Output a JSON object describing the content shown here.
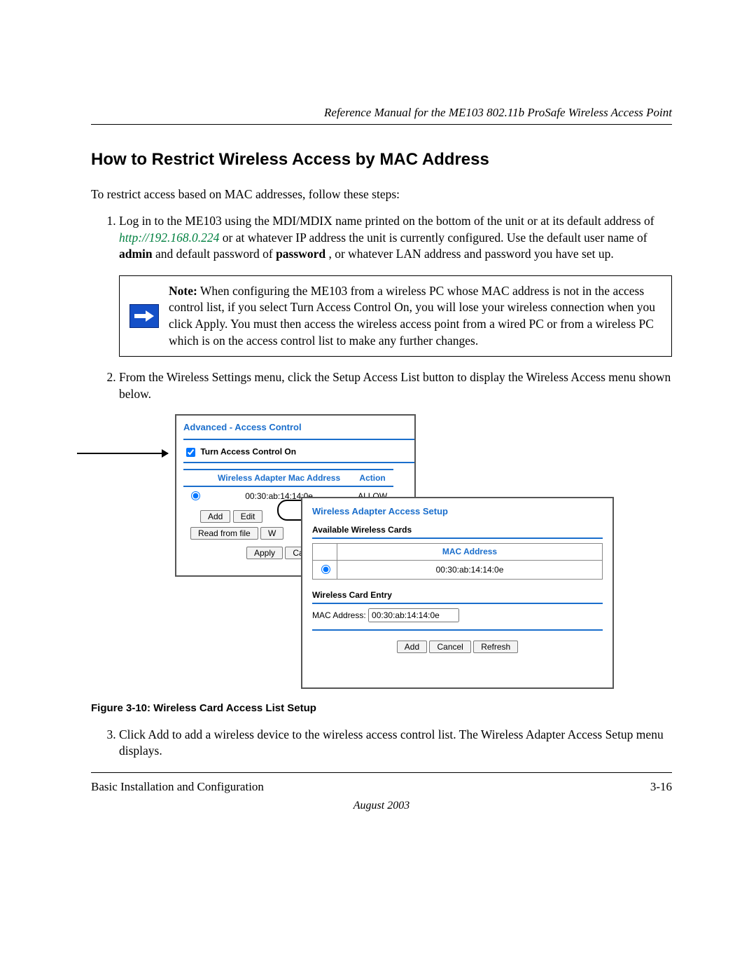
{
  "header": {
    "running_head": "Reference Manual for the ME103 802.11b ProSafe Wireless Access Point"
  },
  "title": "How to Restrict Wireless Access by MAC Address",
  "intro": "To restrict access based on MAC addresses, follow these steps:",
  "steps": {
    "s1a": "Log in to the ME103 using the MDI/MDIX name printed on the bottom of the unit or at its default address of ",
    "s1_url": "http://192.168.0.224",
    "s1b": " or at whatever IP address the unit is currently configured. Use the default user name of ",
    "s1_user": "admin",
    "s1c": " and default password of ",
    "s1_pass": "password",
    "s1d": ", or whatever LAN address and password you have set up.",
    "s2": "From the Wireless Settings menu, click the Setup Access List button to display the Wireless Access menu shown below.",
    "s3": "Click Add to add a wireless device to the wireless access control list. The Wireless Adapter Access Setup menu displays."
  },
  "note": {
    "label": "Note:",
    "text": " When configuring the ME103 from a wireless PC whose MAC address is not in the access control list, if you select Turn Access Control On, you will lose your wireless connection when you click Apply. You must then access the wireless access point from a wired PC or from a wireless PC which is on the access control list to make any further changes."
  },
  "figure": {
    "panel1": {
      "title": "Advanced - Access Control",
      "checkbox_label": "Turn Access Control On",
      "col_mac": "Wireless Adapter Mac Address",
      "col_action": "Action",
      "row_mac": "00:30:ab:14:14:0e",
      "row_action": "ALLOW",
      "btn_add": "Add",
      "btn_edit": "Edit",
      "btn_read": "Read from file",
      "btn_w": "W",
      "btn_apply": "Apply",
      "btn_cancel": "Cance"
    },
    "panel2": {
      "title": "Wireless Adapter Access Setup",
      "avail_head": "Available Wireless Cards",
      "col_mac": "MAC Address",
      "row_mac": "00:30:ab:14:14:0e",
      "entry_head": "Wireless Card Entry",
      "entry_label": "MAC Address:",
      "entry_value": "00:30:ab:14:14:0e",
      "btn_add": "Add",
      "btn_cancel": "Cancel",
      "btn_refresh": "Refresh"
    },
    "caption": "Figure 3-10: Wireless Card Access List Setup"
  },
  "footer": {
    "left": "Basic Installation and Configuration",
    "right": "3-16",
    "date": "August 2003"
  }
}
